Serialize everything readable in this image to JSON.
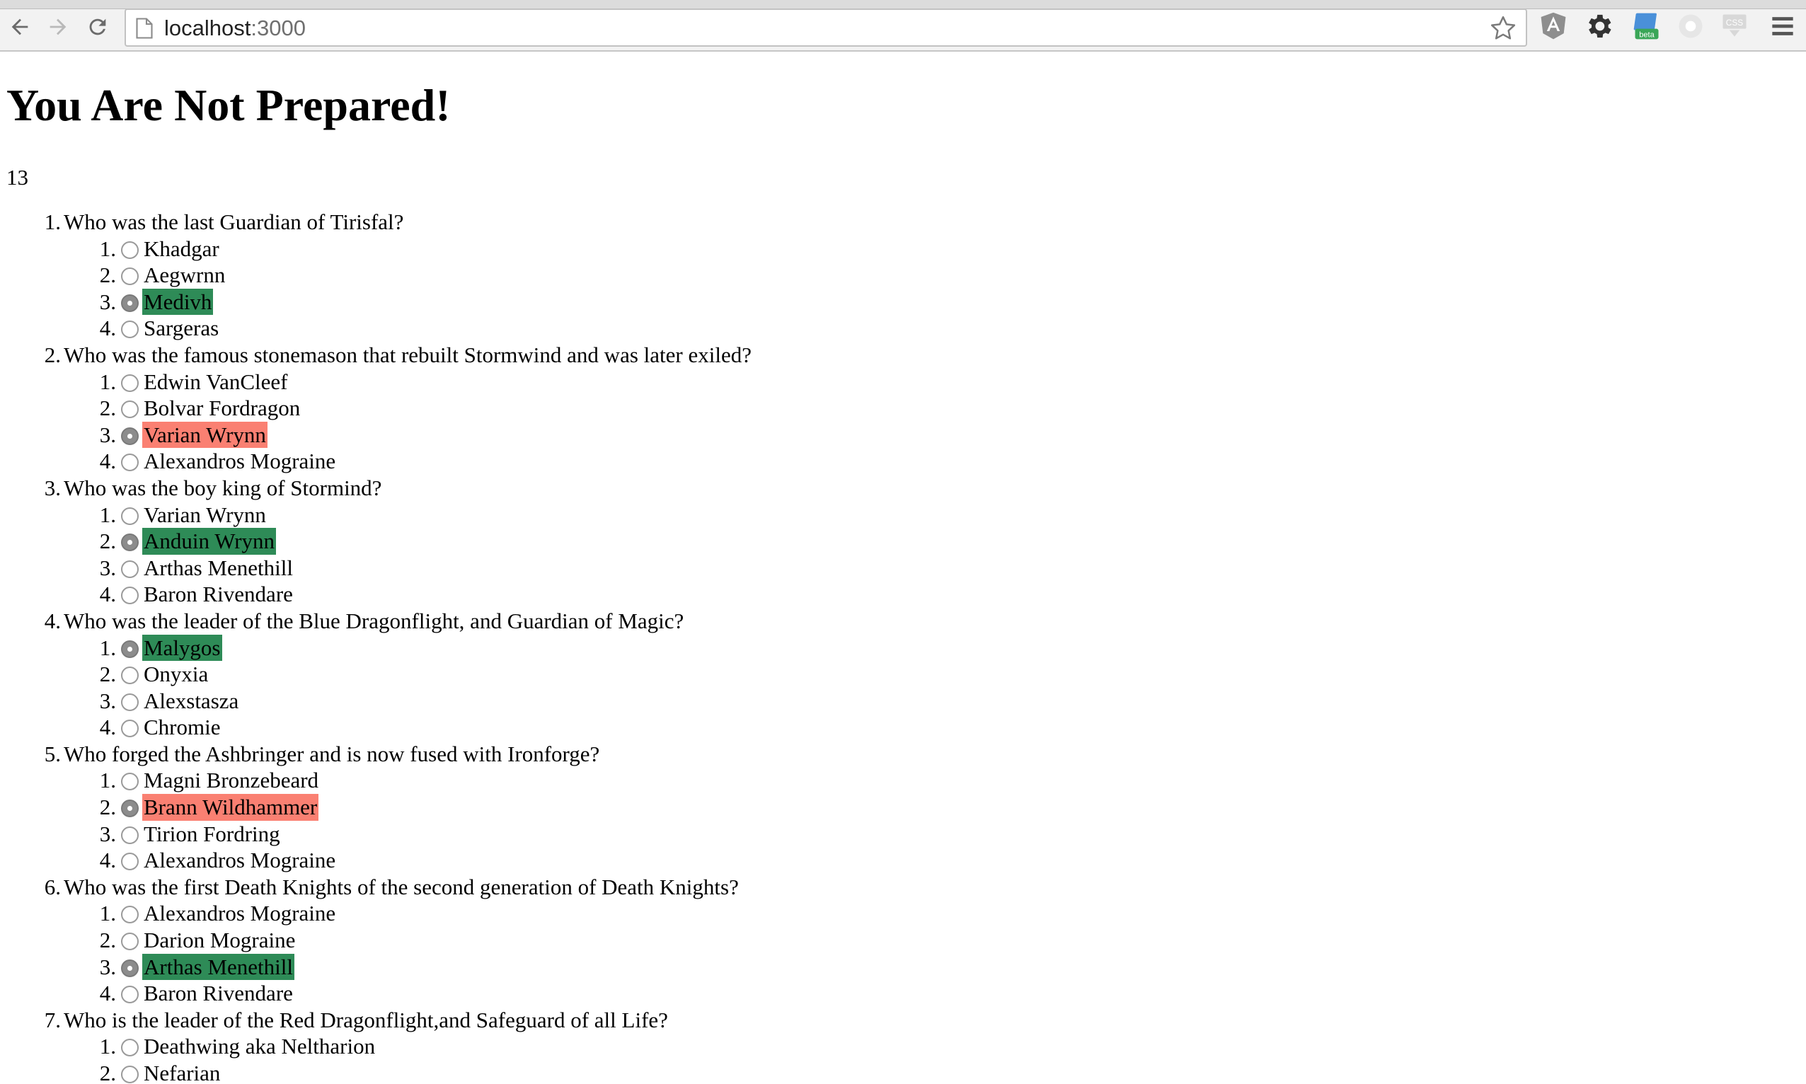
{
  "browser": {
    "url_host": "localhost",
    "url_port": ":3000",
    "extensions": [
      "angular-icon",
      "gear-icon",
      "beta-extension-icon",
      "circle-extension-icon",
      "css-extension-icon",
      "menu-icon"
    ],
    "beta_badge": "beta",
    "css_badge": "CSS"
  },
  "page": {
    "title": "You Are Not Prepared!",
    "score": "13"
  },
  "colors": {
    "correct": "#2e8b57",
    "wrong": "#fa8072"
  },
  "questions": [
    {
      "num": "1.",
      "text": "Who was the last Guardian of Tirisfal?",
      "answers": [
        {
          "num": "1.",
          "text": "Khadgar",
          "state": ""
        },
        {
          "num": "2.",
          "text": "Aegwrnn",
          "state": ""
        },
        {
          "num": "3.",
          "text": "Medivh",
          "state": "correct"
        },
        {
          "num": "4.",
          "text": "Sargeras",
          "state": ""
        }
      ]
    },
    {
      "num": "2.",
      "text": "Who was the famous stonemason that rebuilt Stormwind and was later exiled?",
      "answers": [
        {
          "num": "1.",
          "text": "Edwin VanCleef",
          "state": ""
        },
        {
          "num": "2.",
          "text": "Bolvar Fordragon",
          "state": ""
        },
        {
          "num": "3.",
          "text": "Varian Wrynn",
          "state": "wrong"
        },
        {
          "num": "4.",
          "text": "Alexandros Mograine",
          "state": ""
        }
      ]
    },
    {
      "num": "3.",
      "text": "Who was the boy king of Stormind?",
      "answers": [
        {
          "num": "1.",
          "text": "Varian Wrynn",
          "state": ""
        },
        {
          "num": "2.",
          "text": "Anduin Wrynn",
          "state": "correct"
        },
        {
          "num": "3.",
          "text": "Arthas Menethill",
          "state": ""
        },
        {
          "num": "4.",
          "text": "Baron Rivendare",
          "state": ""
        }
      ]
    },
    {
      "num": "4.",
      "text": "Who was the leader of the Blue Dragonflight, and Guardian of Magic?",
      "answers": [
        {
          "num": "1.",
          "text": "Malygos",
          "state": "correct"
        },
        {
          "num": "2.",
          "text": "Onyxia",
          "state": ""
        },
        {
          "num": "3.",
          "text": "Alexstasza",
          "state": ""
        },
        {
          "num": "4.",
          "text": "Chromie",
          "state": ""
        }
      ]
    },
    {
      "num": "5.",
      "text": "Who forged the Ashbringer and is now fused with Ironforge?",
      "answers": [
        {
          "num": "1.",
          "text": "Magni Bronzebeard",
          "state": ""
        },
        {
          "num": "2.",
          "text": "Brann Wildhammer",
          "state": "wrong"
        },
        {
          "num": "3.",
          "text": "Tirion Fordring",
          "state": ""
        },
        {
          "num": "4.",
          "text": "Alexandros Mograine",
          "state": ""
        }
      ]
    },
    {
      "num": "6.",
      "text": "Who was the first Death Knights of the second generation of Death Knights?",
      "answers": [
        {
          "num": "1.",
          "text": "Alexandros Mograine",
          "state": ""
        },
        {
          "num": "2.",
          "text": "Darion Mograine",
          "state": ""
        },
        {
          "num": "3.",
          "text": "Arthas Menethill",
          "state": "correct"
        },
        {
          "num": "4.",
          "text": "Baron Rivendare",
          "state": ""
        }
      ]
    },
    {
      "num": "7.",
      "text": "Who is the leader of the Red Dragonflight,and Safeguard of all Life?",
      "answers": [
        {
          "num": "1.",
          "text": "Deathwing aka Neltharion",
          "state": ""
        },
        {
          "num": "2.",
          "text": "Nefarian",
          "state": ""
        }
      ]
    }
  ]
}
